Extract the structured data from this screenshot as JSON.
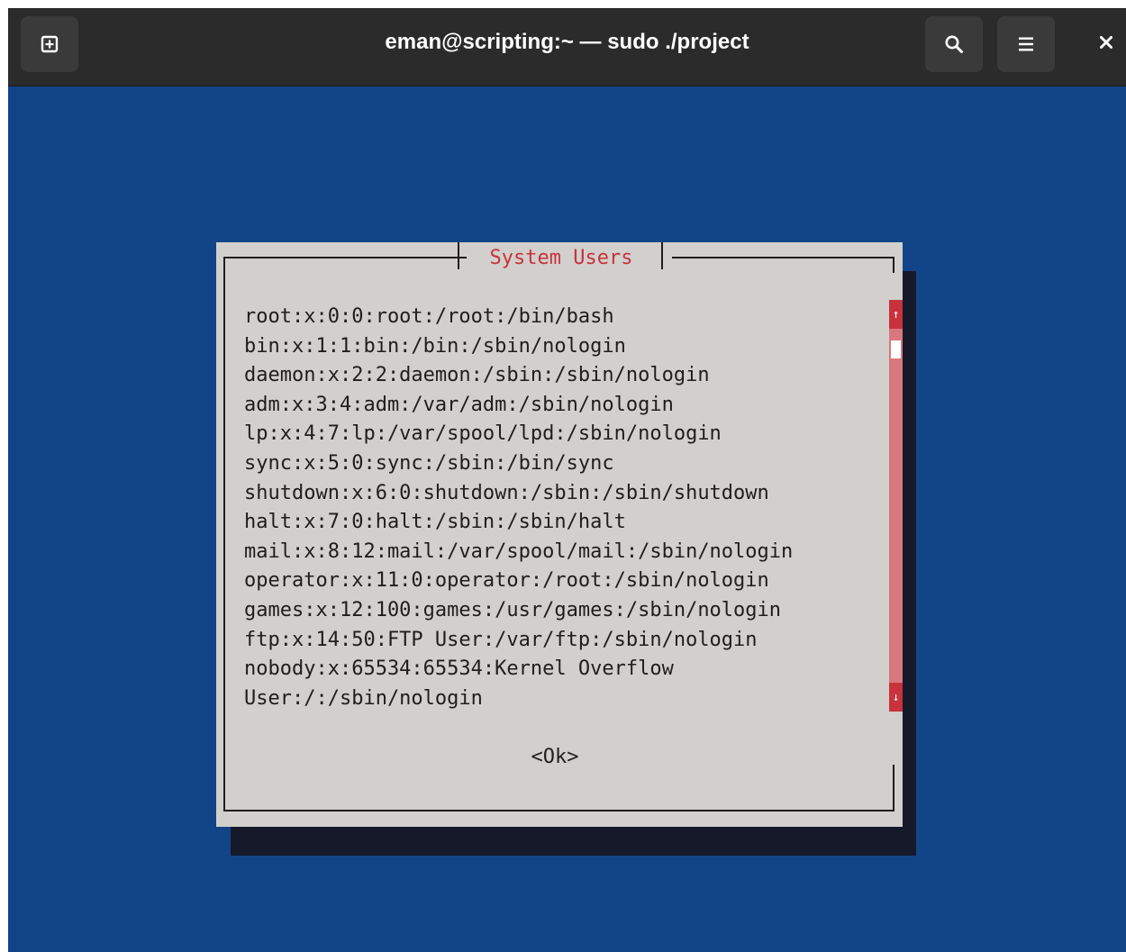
{
  "window": {
    "title": "eman@scripting:~ — sudo ./project"
  },
  "toolbar": {
    "icons": [
      "new-tab-icon",
      "search-icon",
      "hamburger-menu-icon",
      "close-icon"
    ]
  },
  "colors": {
    "terminal_background": "#124588",
    "dialog_background": "#d1d0cc",
    "dialog_title": "#c8323c",
    "scrollbar_track": "#d9777e",
    "scrollbar_arrow": "#c8323c",
    "shadow": "#16192a"
  },
  "dialog": {
    "title": " System Users ",
    "lines": [
      "root:x:0:0:root:/root:/bin/bash",
      "bin:x:1:1:bin:/bin:/sbin/nologin",
      "daemon:x:2:2:daemon:/sbin:/sbin/nologin",
      "adm:x:3:4:adm:/var/adm:/sbin/nologin",
      "lp:x:4:7:lp:/var/spool/lpd:/sbin/nologin",
      "sync:x:5:0:sync:/sbin:/bin/sync",
      "shutdown:x:6:0:shutdown:/sbin:/sbin/shutdown",
      "halt:x:7:0:halt:/sbin:/sbin/halt",
      "mail:x:8:12:mail:/var/spool/mail:/sbin/nologin",
      "operator:x:11:0:operator:/root:/sbin/nologin",
      "games:x:12:100:games:/usr/games:/sbin/nologin",
      "ftp:x:14:50:FTP User:/var/ftp:/sbin/nologin",
      "nobody:x:65534:65534:Kernel Overflow",
      "User:/:/sbin/nologin"
    ],
    "scroll_up_arrow": "↑",
    "scroll_down_arrow": "↓",
    "ok_label": "<Ok>"
  }
}
